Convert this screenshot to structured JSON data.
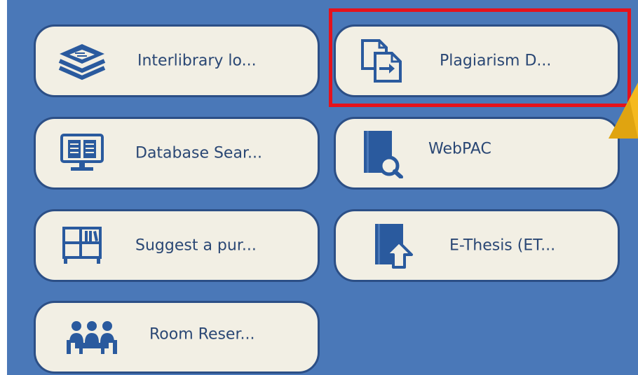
{
  "colors": {
    "panel_bg": "#4a78b8",
    "tile_bg": "#f2efe4",
    "tile_border": "#2c4f86",
    "text": "#2a4774",
    "icon": "#2a5a9e",
    "highlight": "#e5121b",
    "pointer": "#f5b91f"
  },
  "tiles": [
    {
      "label": "Interlibrary lo...",
      "icon": "stacked-layers-icon"
    },
    {
      "label": "Plagiarism D...",
      "icon": "document-compare-icon"
    },
    {
      "label": "Database Sear...",
      "icon": "monitor-book-icon"
    },
    {
      "label": "WebPAC",
      "icon": "book-search-icon"
    },
    {
      "label": "Suggest a pur...",
      "icon": "bookshelf-icon"
    },
    {
      "label": "E-Thesis (ET...",
      "icon": "book-upload-icon"
    },
    {
      "label": "Room Reser...",
      "icon": "meeting-room-icon"
    }
  ],
  "highlighted_tile": "Plagiarism D..."
}
